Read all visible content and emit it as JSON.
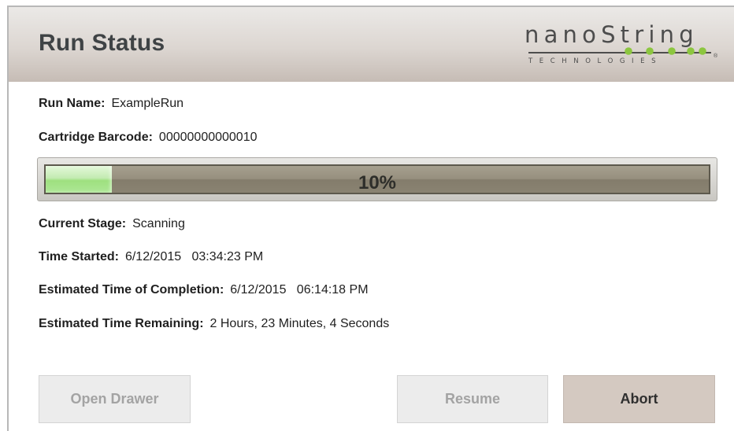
{
  "header": {
    "title": "Run Status",
    "logo": {
      "word": "nanoString",
      "subtitle": "TECHNOLOGIES",
      "registered": "®",
      "dot_color": "#8cc63f"
    }
  },
  "run": {
    "name_label": "Run Name:",
    "name_value": "ExampleRun",
    "barcode_label": "Cartridge Barcode:",
    "barcode_value": "00000000000010"
  },
  "progress": {
    "percent": 10,
    "text": "10%",
    "fill_color": "#a8e38a"
  },
  "status": {
    "stage_label": "Current Stage:",
    "stage_value": "Scanning",
    "started_label": "Time Started:",
    "started_value": "6/12/2015   03:34:23 PM",
    "completion_label": "Estimated Time of Completion:",
    "completion_value": "6/12/2015   06:14:18 PM",
    "remaining_label": "Estimated Time Remaining:",
    "remaining_value": "2 Hours, 23 Minutes, 4 Seconds"
  },
  "buttons": {
    "open_drawer": {
      "label": "Open Drawer",
      "enabled": false
    },
    "resume": {
      "label": "Resume",
      "enabled": false
    },
    "abort": {
      "label": "Abort",
      "enabled": true
    }
  }
}
